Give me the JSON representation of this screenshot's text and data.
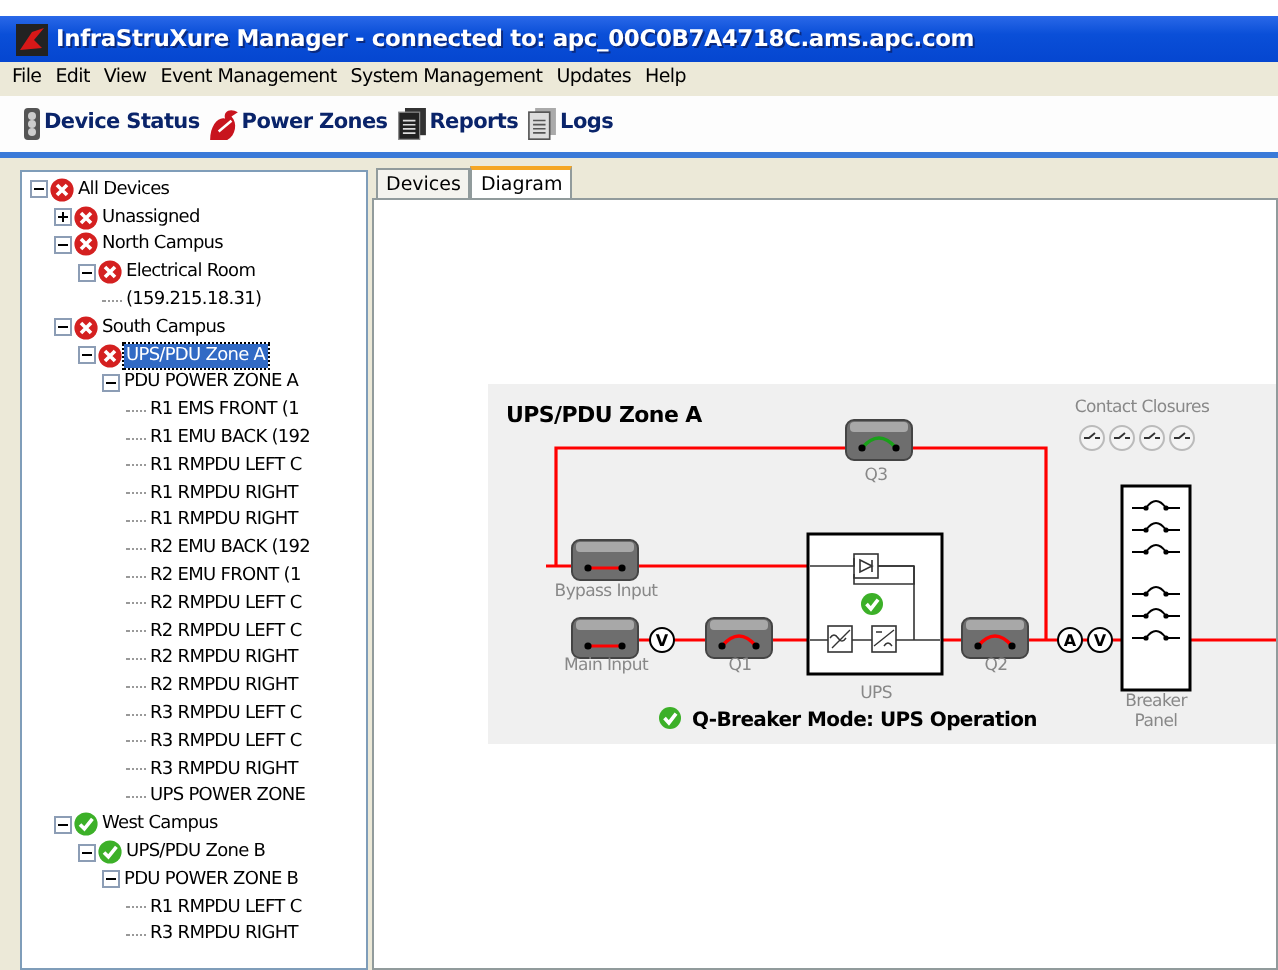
{
  "window": {
    "title": "InfraStruXure Manager - connected to: apc_00C0B7A4718C.ams.apc.com"
  },
  "menu": [
    "File",
    "Edit",
    "View",
    "Event Management",
    "System Management",
    "Updates",
    "Help"
  ],
  "toolbar": [
    {
      "label": "Device Status",
      "kind": "status"
    },
    {
      "label": "Power Zones",
      "kind": "zones"
    },
    {
      "label": "Reports",
      "kind": "reports"
    },
    {
      "label": "Logs",
      "kind": "logs"
    }
  ],
  "tree": [
    {
      "label": "All Devices",
      "ok": false,
      "expanded": true,
      "selected": false,
      "children": [
        {
          "label": "Unassigned",
          "ok": false,
          "expanded": false,
          "selected": false
        },
        {
          "label": "North Campus",
          "ok": false,
          "expanded": true,
          "selected": false,
          "children": [
            {
              "label": "Electrical Room",
              "ok": false,
              "expanded": true,
              "selected": false,
              "children": [
                {
                  "label": "(159.215.18.31)",
                  "selected": false
                }
              ]
            }
          ]
        },
        {
          "label": "South Campus",
          "ok": false,
          "expanded": true,
          "selected": false,
          "children": [
            {
              "label": "UPS/PDU Zone A",
              "ok": false,
              "expanded": true,
              "selected": true,
              "children": [
                {
                  "label": "PDU POWER ZONE A",
                  "expanded": true,
                  "selected": false,
                  "children": [
                    {
                      "label": "R1 EMS FRONT (1",
                      "selected": false
                    },
                    {
                      "label": "R1 EMU BACK (192",
                      "selected": false
                    },
                    {
                      "label": "R1 RMPDU LEFT C",
                      "selected": false
                    },
                    {
                      "label": "R1 RMPDU RIGHT",
                      "selected": false
                    },
                    {
                      "label": "R1 RMPDU RIGHT",
                      "selected": false
                    },
                    {
                      "label": "R2 EMU BACK (192",
                      "selected": false
                    },
                    {
                      "label": "R2 EMU FRONT (1",
                      "selected": false
                    },
                    {
                      "label": "R2 RMPDU LEFT C",
                      "selected": false
                    },
                    {
                      "label": "R2 RMPDU LEFT C",
                      "selected": false
                    },
                    {
                      "label": "R2 RMPDU RIGHT",
                      "selected": false
                    },
                    {
                      "label": "R2 RMPDU RIGHT",
                      "selected": false
                    },
                    {
                      "label": "R3 RMPDU LEFT C",
                      "selected": false
                    },
                    {
                      "label": "R3 RMPDU LEFT C",
                      "selected": false
                    },
                    {
                      "label": "R3 RMPDU RIGHT",
                      "selected": false
                    },
                    {
                      "label": "UPS POWER ZONE",
                      "selected": false
                    }
                  ]
                }
              ]
            }
          ]
        },
        {
          "label": "West Campus",
          "ok": true,
          "expanded": true,
          "selected": false,
          "children": [
            {
              "label": "UPS/PDU Zone B",
              "ok": true,
              "expanded": true,
              "selected": false,
              "children": [
                {
                  "label": "PDU POWER ZONE B",
                  "expanded": true,
                  "selected": false,
                  "children": [
                    {
                      "label": "R1 RMPDU LEFT C",
                      "selected": false
                    },
                    {
                      "label": "R3 RMPDU RIGHT",
                      "selected": false
                    }
                  ]
                }
              ]
            }
          ]
        }
      ]
    }
  ],
  "tabs": [
    {
      "label": "Devices",
      "selected": false
    },
    {
      "label": "Diagram",
      "selected": true
    }
  ],
  "diagram": {
    "title": "UPS/PDU Zone A",
    "contact_closures": {
      "label": "Contact Closures",
      "contacts": [
        {
          "closed": false
        },
        {
          "closed": false
        },
        {
          "closed": false
        },
        {
          "closed": false
        }
      ]
    },
    "breakers": [
      {
        "label": "Q3",
        "kind": "breaker",
        "closed": false
      },
      {
        "label": "Bypass Input",
        "kind": "input"
      },
      {
        "label": "Main Input",
        "kind": "input"
      },
      {
        "label": "Q1",
        "kind": "breaker",
        "closed": true
      },
      {
        "label": "Q2",
        "kind": "breaker",
        "closed": true
      }
    ],
    "meters": [
      "V",
      "A",
      "V"
    ],
    "ups": {
      "label": "UPS",
      "ok": true
    },
    "breaker_panel": {
      "label_lines": [
        "Breaker",
        "Panel"
      ]
    },
    "mode": {
      "text": "Q-Breaker Mode: UPS Operation",
      "ok": true
    }
  }
}
